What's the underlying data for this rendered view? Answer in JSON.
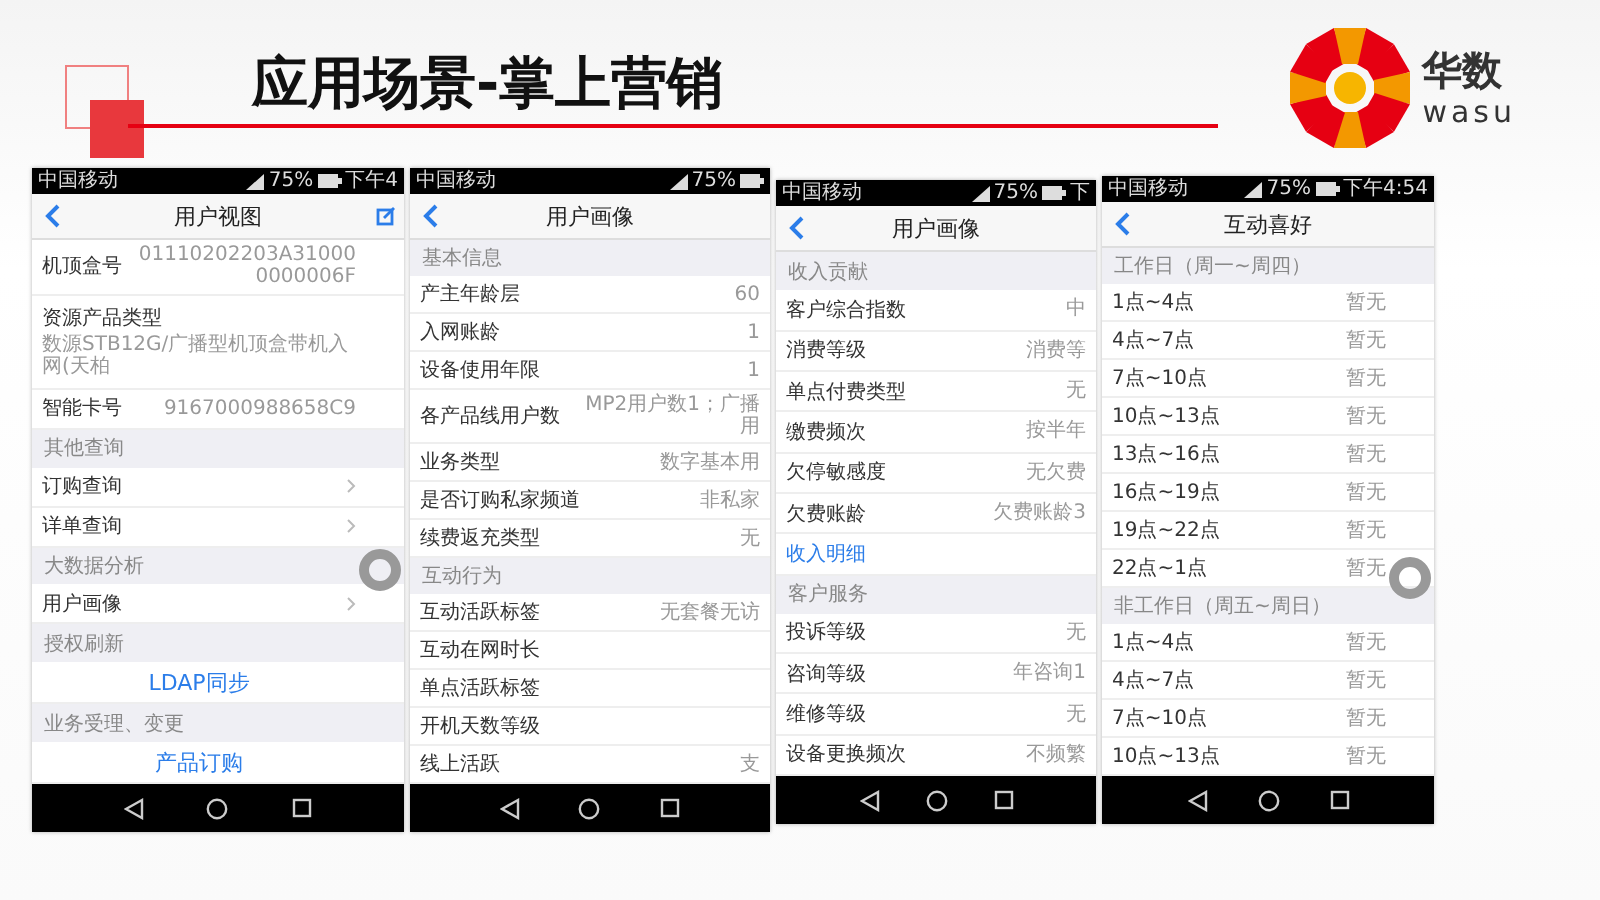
{
  "slide": {
    "title": "应用场景-掌上营销",
    "logo": {
      "name": "华数",
      "latin": "wasu"
    }
  },
  "phones": [
    {
      "status": {
        "carrier": "中国移动",
        "battery": "75%",
        "time": "下午4"
      },
      "title": "用户视图",
      "action_icon": true,
      "floating_button": true,
      "items": [
        {
          "kind": "row",
          "label": "机顶盒号",
          "value": "01110202203A310000000006F",
          "chevron": false
        },
        {
          "kind": "stacked",
          "label": "资源产品类型",
          "value": "数源STB12G/广播型机顶盒带机入网(天柏"
        },
        {
          "kind": "row",
          "label": "智能卡号",
          "value": "9167000988658C9",
          "chevron": false
        },
        {
          "kind": "section",
          "label": "其他查询"
        },
        {
          "kind": "row",
          "label": "订购查询",
          "chevron": true
        },
        {
          "kind": "row",
          "label": "详单查询",
          "chevron": true
        },
        {
          "kind": "section",
          "label": "大数据分析"
        },
        {
          "kind": "row",
          "label": "用户画像",
          "chevron": true
        },
        {
          "kind": "section",
          "label": "授权刷新"
        },
        {
          "kind": "action",
          "label": "LDAP同步"
        },
        {
          "kind": "section",
          "label": "业务受理、变更"
        },
        {
          "kind": "action",
          "label": "产品订购"
        }
      ]
    },
    {
      "status": {
        "carrier": "中国移动",
        "battery": "75%"
      },
      "title": "用户画像",
      "action_icon": false,
      "floating_button": false,
      "items": [
        {
          "kind": "section",
          "label": "基本信息"
        },
        {
          "kind": "row",
          "label": "产主年龄层",
          "value": "60",
          "chevron": false
        },
        {
          "kind": "row",
          "label": "入网账龄",
          "value": "1",
          "chevron": false
        },
        {
          "kind": "row",
          "label": "设备使用年限",
          "value": "1",
          "chevron": false
        },
        {
          "kind": "row",
          "label": "各产品线用户数",
          "value": "MP2用户数1；广播用",
          "chevron": false
        },
        {
          "kind": "row",
          "label": "业务类型",
          "value": "数字基本用",
          "chevron": false
        },
        {
          "kind": "row",
          "label": "是否订购私家频道",
          "value": "非私家",
          "chevron": false
        },
        {
          "kind": "row",
          "label": "续费返充类型",
          "value": "无",
          "chevron": false
        },
        {
          "kind": "section",
          "label": "互动行为"
        },
        {
          "kind": "row",
          "label": "互动活跃标签",
          "value": "无套餐无访",
          "chevron": false
        },
        {
          "kind": "row",
          "label": "互动在网时长",
          "chevron": false
        },
        {
          "kind": "row",
          "label": "单点活跃标签",
          "chevron": false
        },
        {
          "kind": "row",
          "label": "开机天数等级",
          "chevron": false
        },
        {
          "kind": "row",
          "label": "线上活跃",
          "value": "支",
          "chevron": false
        }
      ]
    },
    {
      "status": {
        "carrier": "中国移动",
        "battery": "75%",
        "time": "下"
      },
      "title": "用户画像",
      "action_icon": false,
      "floating_button": false,
      "items": [
        {
          "kind": "section",
          "label": "收入贡献"
        },
        {
          "kind": "row",
          "label": "客户综合指数",
          "value": "中",
          "chevron": false
        },
        {
          "kind": "row",
          "label": "消费等级",
          "value": "消费等",
          "chevron": false
        },
        {
          "kind": "row",
          "label": "单点付费类型",
          "value": "无",
          "chevron": false
        },
        {
          "kind": "row",
          "label": "缴费频次",
          "value": "按半年",
          "chevron": false
        },
        {
          "kind": "row",
          "label": "欠停敏感度",
          "value": "无欠费",
          "chevron": false
        },
        {
          "kind": "row",
          "label": "欠费账龄",
          "value": "欠费账龄3",
          "chevron": false
        },
        {
          "kind": "link",
          "label": "收入明细"
        },
        {
          "kind": "section",
          "label": "客户服务"
        },
        {
          "kind": "row",
          "label": "投诉等级",
          "value": "无",
          "chevron": false
        },
        {
          "kind": "row",
          "label": "咨询等级",
          "value": "年咨询1",
          "chevron": false
        },
        {
          "kind": "row",
          "label": "维修等级",
          "value": "无",
          "chevron": false
        },
        {
          "kind": "row",
          "label": "设备更换频次",
          "value": "不频繁",
          "chevron": false
        }
      ]
    },
    {
      "status": {
        "carrier": "中国移动",
        "battery": "75%",
        "time": "下午4:54"
      },
      "title": "互动喜好",
      "action_icon": false,
      "floating_button": true,
      "items": [
        {
          "kind": "section",
          "label": "工作日（周一~周四）"
        },
        {
          "kind": "row",
          "label": "1点~4点",
          "value": "暂无",
          "chevron": false
        },
        {
          "kind": "row",
          "label": "4点~7点",
          "value": "暂无",
          "chevron": false
        },
        {
          "kind": "row",
          "label": "7点~10点",
          "value": "暂无",
          "chevron": false
        },
        {
          "kind": "row",
          "label": "10点~13点",
          "value": "暂无",
          "chevron": false
        },
        {
          "kind": "row",
          "label": "13点~16点",
          "value": "暂无",
          "chevron": false
        },
        {
          "kind": "row",
          "label": "16点~19点",
          "value": "暂无",
          "chevron": false
        },
        {
          "kind": "row",
          "label": "19点~22点",
          "value": "暂无",
          "chevron": false
        },
        {
          "kind": "row",
          "label": "22点~1点",
          "value": "暂无",
          "chevron": false
        },
        {
          "kind": "section",
          "label": "非工作日（周五~周日）"
        },
        {
          "kind": "row",
          "label": "1点~4点",
          "value": "暂无",
          "chevron": false
        },
        {
          "kind": "row",
          "label": "4点~7点",
          "value": "暂无",
          "chevron": false
        },
        {
          "kind": "row",
          "label": "7点~10点",
          "value": "暂无",
          "chevron": false
        },
        {
          "kind": "row",
          "label": "10点~13点",
          "value": "暂无",
          "chevron": false
        }
      ]
    }
  ]
}
